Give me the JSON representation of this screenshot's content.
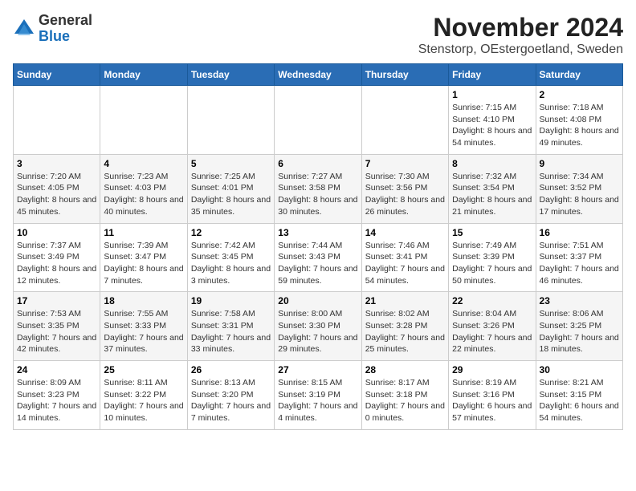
{
  "header": {
    "logo_general": "General",
    "logo_blue": "Blue",
    "month": "November 2024",
    "location": "Stenstorp, OEstergoetland, Sweden"
  },
  "weekdays": [
    "Sunday",
    "Monday",
    "Tuesday",
    "Wednesday",
    "Thursday",
    "Friday",
    "Saturday"
  ],
  "weeks": [
    [
      {
        "day": "",
        "info": ""
      },
      {
        "day": "",
        "info": ""
      },
      {
        "day": "",
        "info": ""
      },
      {
        "day": "",
        "info": ""
      },
      {
        "day": "",
        "info": ""
      },
      {
        "day": "1",
        "info": "Sunrise: 7:15 AM\nSunset: 4:10 PM\nDaylight: 8 hours and 54 minutes."
      },
      {
        "day": "2",
        "info": "Sunrise: 7:18 AM\nSunset: 4:08 PM\nDaylight: 8 hours and 49 minutes."
      }
    ],
    [
      {
        "day": "3",
        "info": "Sunrise: 7:20 AM\nSunset: 4:05 PM\nDaylight: 8 hours and 45 minutes."
      },
      {
        "day": "4",
        "info": "Sunrise: 7:23 AM\nSunset: 4:03 PM\nDaylight: 8 hours and 40 minutes."
      },
      {
        "day": "5",
        "info": "Sunrise: 7:25 AM\nSunset: 4:01 PM\nDaylight: 8 hours and 35 minutes."
      },
      {
        "day": "6",
        "info": "Sunrise: 7:27 AM\nSunset: 3:58 PM\nDaylight: 8 hours and 30 minutes."
      },
      {
        "day": "7",
        "info": "Sunrise: 7:30 AM\nSunset: 3:56 PM\nDaylight: 8 hours and 26 minutes."
      },
      {
        "day": "8",
        "info": "Sunrise: 7:32 AM\nSunset: 3:54 PM\nDaylight: 8 hours and 21 minutes."
      },
      {
        "day": "9",
        "info": "Sunrise: 7:34 AM\nSunset: 3:52 PM\nDaylight: 8 hours and 17 minutes."
      }
    ],
    [
      {
        "day": "10",
        "info": "Sunrise: 7:37 AM\nSunset: 3:49 PM\nDaylight: 8 hours and 12 minutes."
      },
      {
        "day": "11",
        "info": "Sunrise: 7:39 AM\nSunset: 3:47 PM\nDaylight: 8 hours and 7 minutes."
      },
      {
        "day": "12",
        "info": "Sunrise: 7:42 AM\nSunset: 3:45 PM\nDaylight: 8 hours and 3 minutes."
      },
      {
        "day": "13",
        "info": "Sunrise: 7:44 AM\nSunset: 3:43 PM\nDaylight: 7 hours and 59 minutes."
      },
      {
        "day": "14",
        "info": "Sunrise: 7:46 AM\nSunset: 3:41 PM\nDaylight: 7 hours and 54 minutes."
      },
      {
        "day": "15",
        "info": "Sunrise: 7:49 AM\nSunset: 3:39 PM\nDaylight: 7 hours and 50 minutes."
      },
      {
        "day": "16",
        "info": "Sunrise: 7:51 AM\nSunset: 3:37 PM\nDaylight: 7 hours and 46 minutes."
      }
    ],
    [
      {
        "day": "17",
        "info": "Sunrise: 7:53 AM\nSunset: 3:35 PM\nDaylight: 7 hours and 42 minutes."
      },
      {
        "day": "18",
        "info": "Sunrise: 7:55 AM\nSunset: 3:33 PM\nDaylight: 7 hours and 37 minutes."
      },
      {
        "day": "19",
        "info": "Sunrise: 7:58 AM\nSunset: 3:31 PM\nDaylight: 7 hours and 33 minutes."
      },
      {
        "day": "20",
        "info": "Sunrise: 8:00 AM\nSunset: 3:30 PM\nDaylight: 7 hours and 29 minutes."
      },
      {
        "day": "21",
        "info": "Sunrise: 8:02 AM\nSunset: 3:28 PM\nDaylight: 7 hours and 25 minutes."
      },
      {
        "day": "22",
        "info": "Sunrise: 8:04 AM\nSunset: 3:26 PM\nDaylight: 7 hours and 22 minutes."
      },
      {
        "day": "23",
        "info": "Sunrise: 8:06 AM\nSunset: 3:25 PM\nDaylight: 7 hours and 18 minutes."
      }
    ],
    [
      {
        "day": "24",
        "info": "Sunrise: 8:09 AM\nSunset: 3:23 PM\nDaylight: 7 hours and 14 minutes."
      },
      {
        "day": "25",
        "info": "Sunrise: 8:11 AM\nSunset: 3:22 PM\nDaylight: 7 hours and 10 minutes."
      },
      {
        "day": "26",
        "info": "Sunrise: 8:13 AM\nSunset: 3:20 PM\nDaylight: 7 hours and 7 minutes."
      },
      {
        "day": "27",
        "info": "Sunrise: 8:15 AM\nSunset: 3:19 PM\nDaylight: 7 hours and 4 minutes."
      },
      {
        "day": "28",
        "info": "Sunrise: 8:17 AM\nSunset: 3:18 PM\nDaylight: 7 hours and 0 minutes."
      },
      {
        "day": "29",
        "info": "Sunrise: 8:19 AM\nSunset: 3:16 PM\nDaylight: 6 hours and 57 minutes."
      },
      {
        "day": "30",
        "info": "Sunrise: 8:21 AM\nSunset: 3:15 PM\nDaylight: 6 hours and 54 minutes."
      }
    ]
  ]
}
